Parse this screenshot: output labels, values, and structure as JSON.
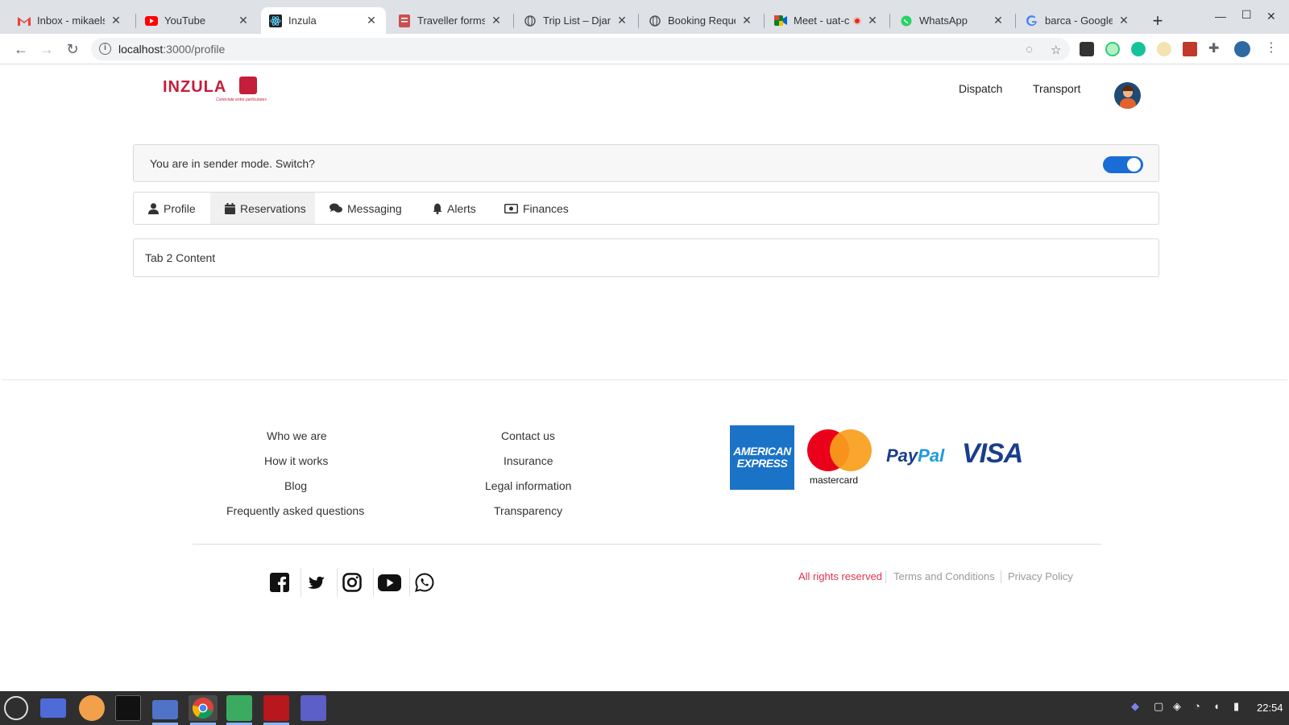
{
  "browser": {
    "tabs": [
      {
        "title": "Inbox - mikaelsc",
        "icon": "gmail-icon",
        "active": false
      },
      {
        "title": "YouTube",
        "icon": "youtube-icon",
        "active": false
      },
      {
        "title": "Inzula",
        "icon": "react-icon",
        "active": true
      },
      {
        "title": "Traveller forms",
        "icon": "forms-icon",
        "active": false
      },
      {
        "title": "Trip List – Djang",
        "icon": "globe-icon",
        "active": false
      },
      {
        "title": "Booking Reque",
        "icon": "globe-icon",
        "active": false
      },
      {
        "title": "Meet - uat-c",
        "icon": "meet-icon",
        "active": false
      },
      {
        "title": "WhatsApp",
        "icon": "whatsapp-icon",
        "active": false
      },
      {
        "title": "barca - Google",
        "icon": "google-icon",
        "active": false
      }
    ],
    "new_tab": "+",
    "address": {
      "host": "localhost",
      "path": ":3000/profile"
    }
  },
  "header": {
    "logo_text": "INZULA",
    "logo_tagline": "Conéctate entre particulares",
    "nav": [
      "Dispatch",
      "Transport"
    ]
  },
  "mode_bar": {
    "text": "You are in sender mode. Switch?",
    "toggle_on": true
  },
  "profile_tabs": [
    {
      "label": "Profile",
      "icon": "user-icon",
      "active": false
    },
    {
      "label": "Reservations",
      "icon": "calendar-icon",
      "active": true
    },
    {
      "label": "Messaging",
      "icon": "comments-icon",
      "active": false
    },
    {
      "label": "Alerts",
      "icon": "bell-icon",
      "active": false
    },
    {
      "label": "Finances",
      "icon": "money-icon",
      "active": false
    }
  ],
  "tab_content": "Tab 2 Content",
  "footer": {
    "col1": [
      "Who we are",
      "How it works",
      "Blog",
      "Frequently asked questions"
    ],
    "col2": [
      "Contact us",
      "Insurance",
      "Legal information",
      "Transparency"
    ],
    "payments": {
      "amex_line1": "AMERICAN",
      "amex_line2": "EXPRESS",
      "mastercard": "mastercard",
      "paypal_1": "Pay",
      "paypal_2": "Pal",
      "visa": "VISA"
    },
    "social": [
      "facebook-icon",
      "twitter-icon",
      "instagram-icon",
      "youtube-icon",
      "whatsapp-icon"
    ],
    "legal": {
      "rights": "All rights reserved",
      "terms": "Terms and Conditions",
      "privacy": "Privacy Policy"
    }
  },
  "taskbar": {
    "clock": "22:54"
  },
  "colors": {
    "brand_red": "#c41e3a",
    "toggle_blue": "#1a6dd6",
    "rights_red": "#e0334e"
  }
}
